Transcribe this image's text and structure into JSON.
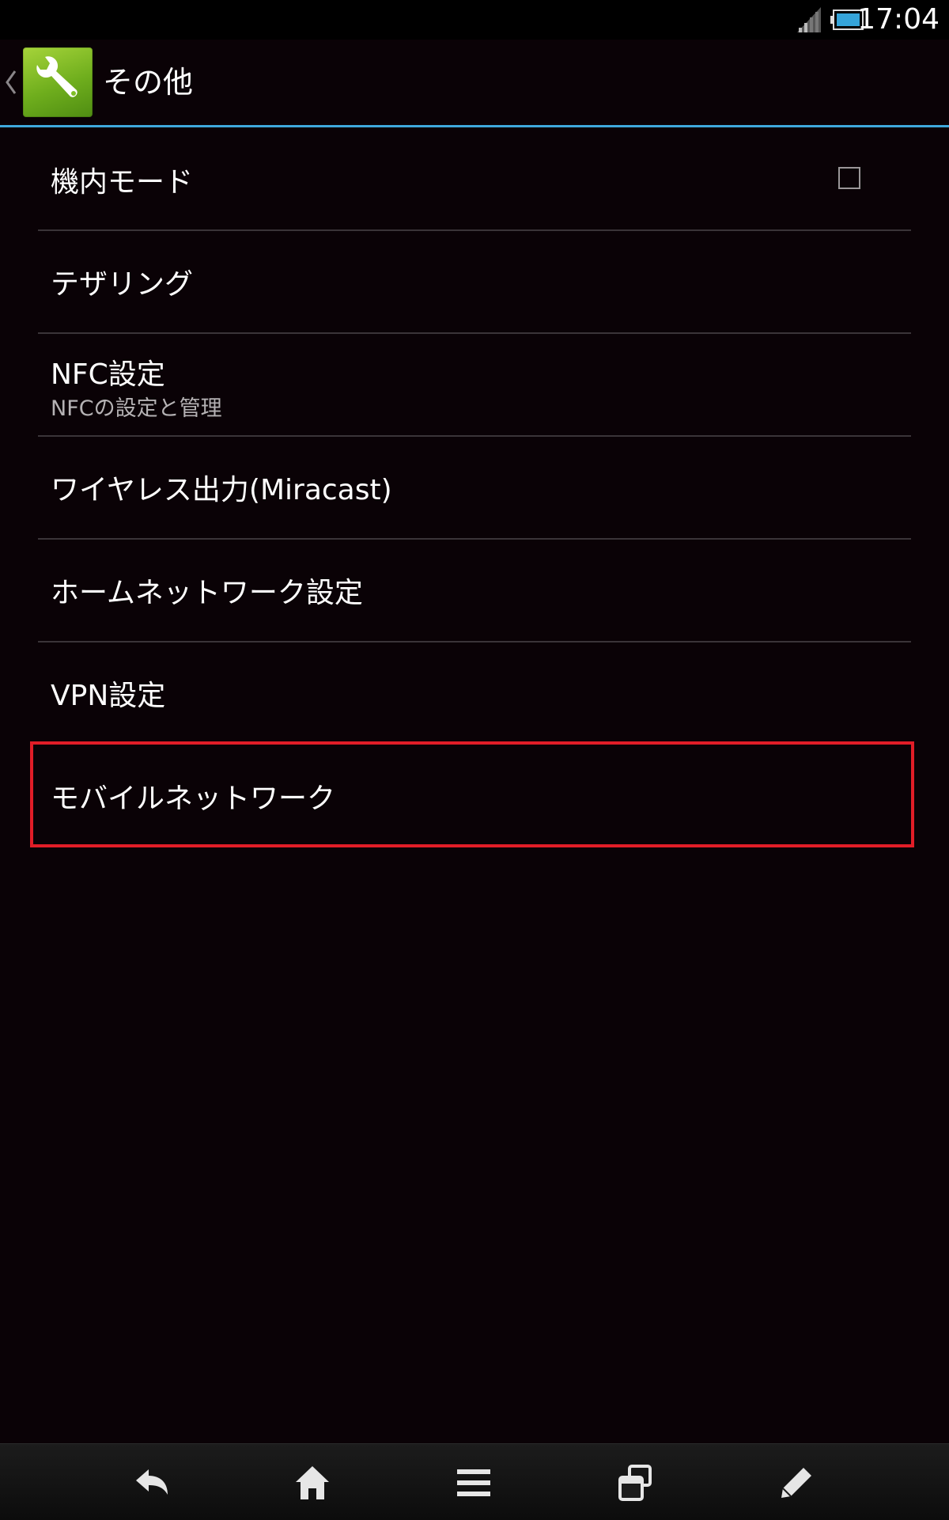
{
  "status_bar": {
    "time": "17:04",
    "icons": [
      "signal-icon",
      "battery-icon"
    ]
  },
  "action_bar": {
    "title": "その他",
    "app_icon": "wrench-icon",
    "up_icon": "chevron-left-icon",
    "accent_color": "#3fa9dc"
  },
  "settings": {
    "items": [
      {
        "title": "機内モード",
        "checked": false
      },
      {
        "title": "テザリング"
      },
      {
        "title": "NFC設定",
        "summary": "NFCの設定と管理"
      },
      {
        "title": "ワイヤレス出力(Miracast)"
      },
      {
        "title": "ホームネットワーク設定"
      },
      {
        "title": "VPN設定"
      },
      {
        "title": "モバイルネットワーク",
        "highlighted": true
      }
    ],
    "highlight_color": "#e11d27"
  },
  "nav_bar": {
    "buttons": [
      "back-icon",
      "home-icon",
      "menu-icon",
      "recent-apps-icon",
      "pen-icon"
    ]
  }
}
